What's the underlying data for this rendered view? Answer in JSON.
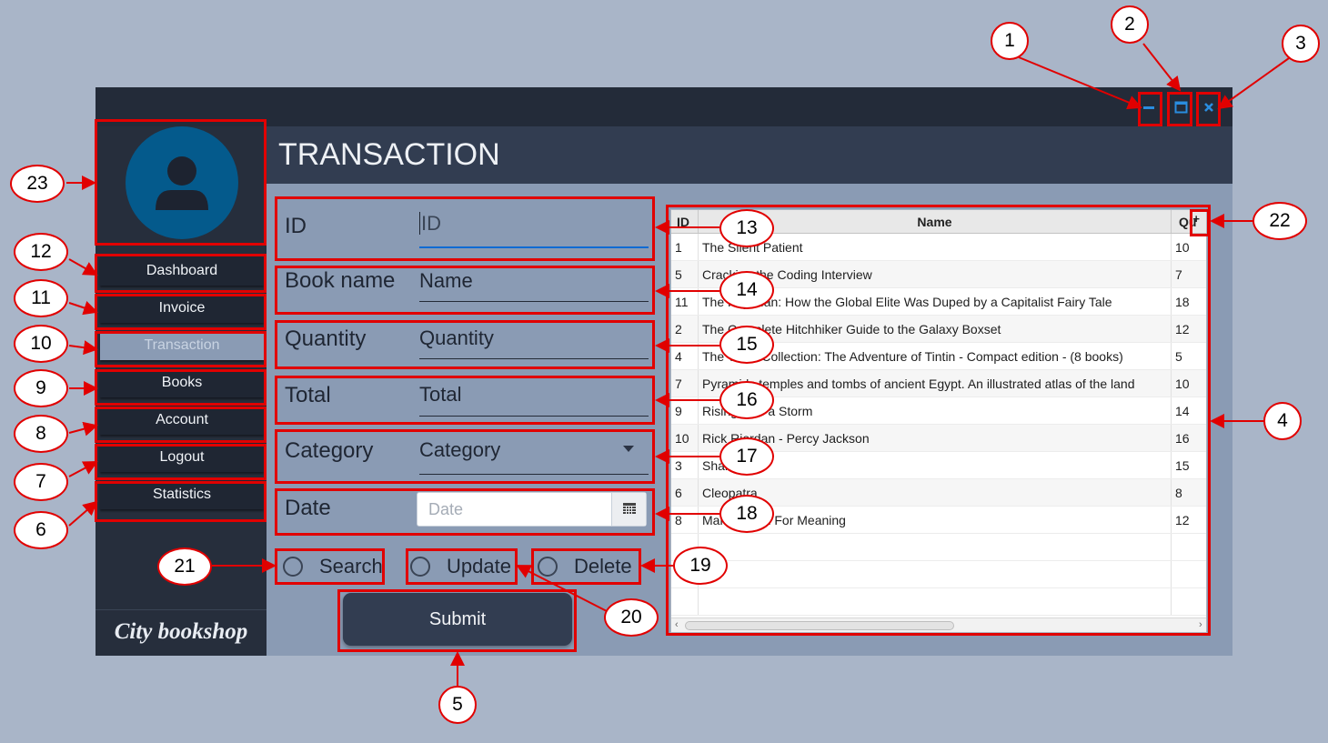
{
  "window": {
    "minimize_glyph": "–",
    "maximize_glyph": "□",
    "close_glyph": "✕"
  },
  "header": {
    "title": "TRANSACTION"
  },
  "sidebar": {
    "items": [
      {
        "label": "Dashboard",
        "active": false
      },
      {
        "label": "Invoice",
        "active": false
      },
      {
        "label": "Transaction",
        "active": true
      },
      {
        "label": "Books",
        "active": false
      },
      {
        "label": "Account",
        "active": false
      },
      {
        "label": "Logout",
        "active": false
      },
      {
        "label": "Statistics",
        "active": false
      }
    ],
    "brand": "City bookshop"
  },
  "form": {
    "id": {
      "label": "ID",
      "placeholder": "ID"
    },
    "book_name": {
      "label": "Book name",
      "placeholder": "Name"
    },
    "quantity": {
      "label": "Quantity",
      "placeholder": "Quantity"
    },
    "total": {
      "label": "Total",
      "placeholder": "Total"
    },
    "category": {
      "label": "Category",
      "placeholder": "Category"
    },
    "date": {
      "label": "Date",
      "placeholder": "Date"
    }
  },
  "radios": [
    {
      "label": "Search"
    },
    {
      "label": "Update"
    },
    {
      "label": "Delete"
    }
  ],
  "submit_label": "Submit",
  "table": {
    "headers": [
      "ID",
      "Name",
      "Qu"
    ],
    "add_column_glyph": "+",
    "rows": [
      [
        "1",
        "The Silent Patient",
        "10"
      ],
      [
        "5",
        "Cracking the Coding Interview",
        "7"
      ],
      [
        "11",
        "The Key Man: How the Global Elite Was Duped by a Capitalist Fairy Tale",
        "18"
      ],
      [
        "2",
        "The Complete Hitchhiker Guide to the Galaxy Boxset",
        "12"
      ],
      [
        "4",
        "The Tintin Collection: The Adventure of Tintin - Compact edition - (8 books)",
        "5"
      ],
      [
        "7",
        "Pyramids temples and tombs of ancient Egypt. An illustrated atlas of the land",
        "10"
      ],
      [
        "9",
        "Rising Like a Storm",
        "14"
      ],
      [
        "10",
        "Rick Riordan - Percy Jackson",
        "16"
      ],
      [
        "3",
        "Shantaram",
        "15"
      ],
      [
        "6",
        "Cleopatra",
        "8"
      ],
      [
        "8",
        "Man Search For Meaning",
        "12"
      ]
    ]
  },
  "annotations": {
    "markers": [
      "1",
      "2",
      "3",
      "4",
      "5",
      "6",
      "7",
      "8",
      "9",
      "10",
      "11",
      "12",
      "13",
      "14",
      "15",
      "16",
      "17",
      "18",
      "19",
      "20",
      "21",
      "22",
      "23"
    ],
    "color": "#e10000"
  },
  "colors": {
    "background": "#a9b5c8",
    "titlebar": "#232b39",
    "sidebar": "#262e3c",
    "content": "#8a9bb4",
    "header": "#323d51",
    "accent_blue": "#2a8de0",
    "avatar": "#045a8c"
  }
}
